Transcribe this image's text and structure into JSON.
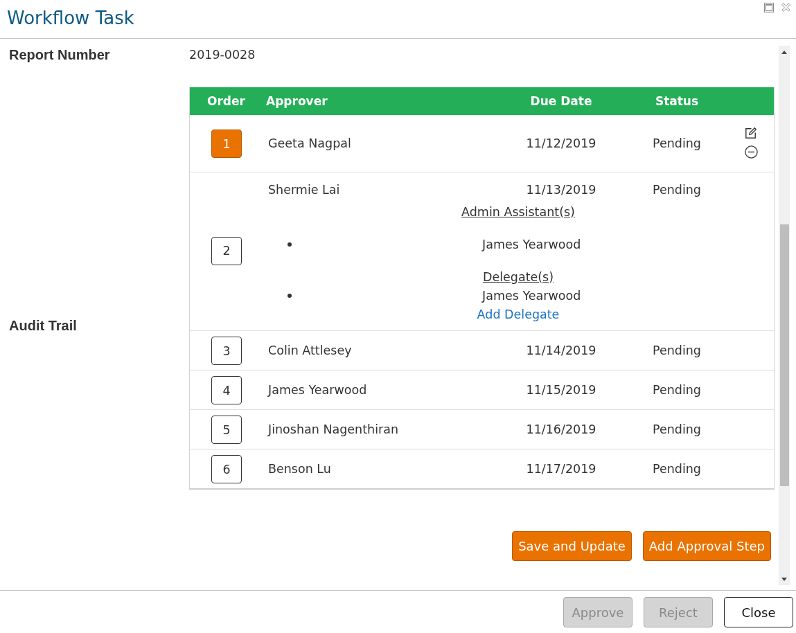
{
  "window": {
    "title": "Workflow Task"
  },
  "report": {
    "label": "Report Number",
    "value": "2019-0028"
  },
  "audit_trail": {
    "label": "Audit Trail",
    "table": {
      "columns": [
        "Order",
        "Approver",
        "Due Date",
        "Status"
      ],
      "rows": [
        {
          "order": "1",
          "selected": true,
          "approver": "Geeta Nagpal",
          "due_date": "11/12/2019",
          "status": "Pending",
          "editable": true
        },
        {
          "order": "2",
          "selected": false,
          "approver": "Shermie Lai",
          "due_date": "11/13/2019",
          "status": "Pending",
          "editable": false,
          "groups": [
            {
              "heading": "Admin Assistant(s)",
              "names": [
                "James Yearwood"
              ]
            },
            {
              "heading": "Delegate(s)",
              "names": [
                "James Yearwood"
              ]
            }
          ],
          "link": "Add Delegate"
        },
        {
          "order": "3",
          "selected": false,
          "approver": "Colin Attlesey",
          "due_date": "11/14/2019",
          "status": "Pending",
          "editable": false
        },
        {
          "order": "4",
          "selected": false,
          "approver": "James Yearwood",
          "due_date": "11/15/2019",
          "status": "Pending",
          "editable": false
        },
        {
          "order": "5",
          "selected": false,
          "approver": "Jinoshan Nagenthiran",
          "due_date": "11/16/2019",
          "status": "Pending",
          "editable": false
        },
        {
          "order": "6",
          "selected": false,
          "approver": "Benson Lu",
          "due_date": "11/17/2019",
          "status": "Pending",
          "editable": false
        }
      ]
    },
    "buttons": [
      "Save and Update",
      "Add Approval Step"
    ]
  },
  "footer": {
    "buttons": [
      {
        "label": "Approve",
        "disabled": true
      },
      {
        "label": "Reject",
        "disabled": true
      },
      {
        "label": "Close",
        "disabled": false
      }
    ]
  }
}
